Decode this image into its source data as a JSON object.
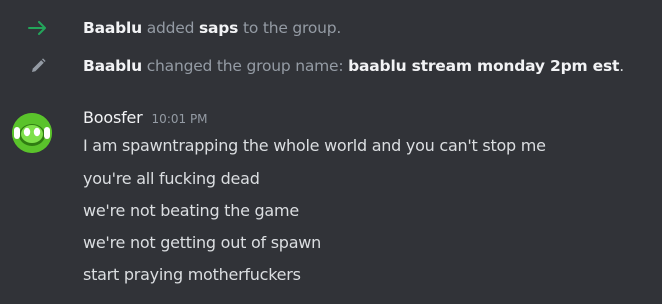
{
  "system_messages": [
    {
      "icon": "arrow-right-icon",
      "icon_color": "#23a55a",
      "actor": "Baablu",
      "action": " added ",
      "target": "saps",
      "suffix": " to the group."
    },
    {
      "icon": "pencil-icon",
      "icon_color": "#949ba4",
      "actor": "Baablu",
      "action": " changed the group name: ",
      "target": "baablu stream monday 2pm est",
      "suffix": "."
    }
  ],
  "message": {
    "author": "Boosfer",
    "timestamp": "10:01 PM",
    "avatar_color": "#5ac32b",
    "lines": [
      "I am spawntrapping the whole world and you can't stop me",
      "you're all fucking dead",
      "we're not beating the game",
      "we're not getting out of spawn",
      "start praying motherfuckers"
    ]
  }
}
